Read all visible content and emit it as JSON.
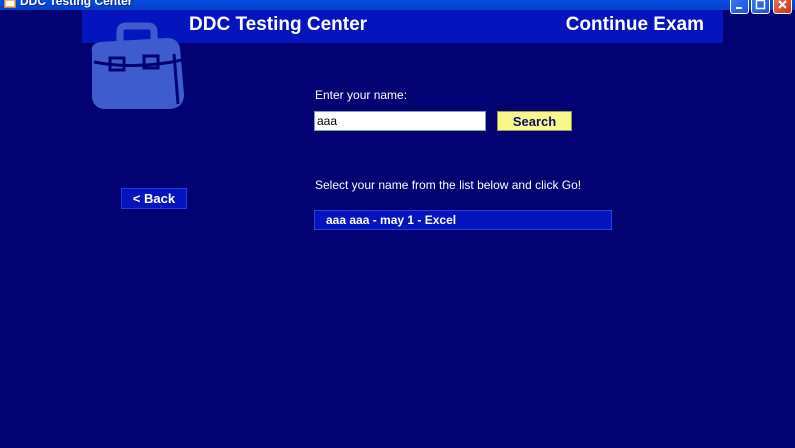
{
  "window": {
    "title": "DDC Testing Center",
    "controls": [
      "minimize-icon",
      "maximize-icon",
      "close-icon"
    ]
  },
  "header": {
    "title": "DDC Testing Center",
    "section": "Continue Exam"
  },
  "logo": {
    "icon": "briefcase-icon"
  },
  "form": {
    "name_label": "Enter your name:",
    "name_value": "aaa",
    "search_label": "Search"
  },
  "nav": {
    "back_label": "< Back"
  },
  "results": {
    "instruction": "Select your name from the list below and click Go!",
    "items": [
      {
        "label": "aaa aaa - may 1 - Excel"
      }
    ]
  },
  "colors": {
    "background": "#030272",
    "banner": "#0415bd",
    "search_button": "#f8f88a",
    "logo": "#3f5ccf"
  }
}
